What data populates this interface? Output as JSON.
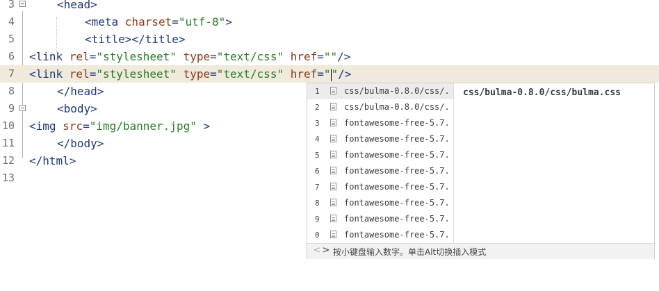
{
  "editor": {
    "lines": [
      {
        "num": "3",
        "parts": [
          [
            "tag",
            "<head>"
          ]
        ]
      },
      {
        "num": "4",
        "parts": [
          [
            "tag",
            "<meta "
          ],
          [
            "attr",
            "charset"
          ],
          [
            "eq",
            "="
          ],
          [
            "str",
            "\"utf-8\""
          ],
          [
            "tag",
            ">"
          ]
        ]
      },
      {
        "num": "5",
        "parts": [
          [
            "tag",
            "<title></title>"
          ]
        ]
      },
      {
        "num": "6",
        "parts": [
          [
            "tag",
            "<link "
          ],
          [
            "attr",
            "rel"
          ],
          [
            "eq",
            "="
          ],
          [
            "str",
            "\"stylesheet\""
          ],
          [
            "tag",
            " "
          ],
          [
            "attr",
            "type"
          ],
          [
            "eq",
            "="
          ],
          [
            "str",
            "\"text/css\""
          ],
          [
            "tag",
            " "
          ],
          [
            "attr",
            "href"
          ],
          [
            "eq",
            "="
          ],
          [
            "str",
            "\"\""
          ],
          [
            "tag",
            "/>"
          ]
        ]
      },
      {
        "num": "7",
        "parts": [
          [
            "tag",
            "<link "
          ],
          [
            "attr",
            "rel"
          ],
          [
            "eq",
            "="
          ],
          [
            "str",
            "\"stylesheet\""
          ],
          [
            "tag",
            " "
          ],
          [
            "attr",
            "type"
          ],
          [
            "eq",
            "="
          ],
          [
            "str",
            "\"text/css\""
          ],
          [
            "tag",
            " "
          ],
          [
            "attr",
            "href"
          ],
          [
            "eq",
            "="
          ],
          [
            "str",
            "\""
          ],
          [
            "caret",
            ""
          ],
          [
            "str",
            "\""
          ],
          [
            "tag",
            "/>"
          ]
        ]
      },
      {
        "num": "8",
        "parts": [
          [
            "tag",
            "</head>"
          ]
        ]
      },
      {
        "num": "9",
        "parts": [
          [
            "tag",
            "<body>"
          ]
        ]
      },
      {
        "num": "10",
        "parts": [
          [
            "tag",
            "<img "
          ],
          [
            "attr",
            "src"
          ],
          [
            "eq",
            "="
          ],
          [
            "str",
            "\"img/banner.jpg\""
          ],
          [
            "tag",
            " >"
          ]
        ]
      },
      {
        "num": "11",
        "parts": [
          [
            "tag",
            "</body>"
          ]
        ]
      },
      {
        "num": "12",
        "parts": [
          [
            "tag",
            "</html>"
          ]
        ]
      },
      {
        "num": "13",
        "parts": []
      }
    ]
  },
  "autocomplete": {
    "items": [
      {
        "num": "1",
        "text": "css/bulma-0.8.0/css/..."
      },
      {
        "num": "2",
        "text": "css/bulma-0.8.0/css/..."
      },
      {
        "num": "3",
        "text": "fontawesome-free-5.7..."
      },
      {
        "num": "4",
        "text": "fontawesome-free-5.7..."
      },
      {
        "num": "5",
        "text": "fontawesome-free-5.7..."
      },
      {
        "num": "6",
        "text": "fontawesome-free-5.7..."
      },
      {
        "num": "7",
        "text": "fontawesome-free-5.7..."
      },
      {
        "num": "8",
        "text": "fontawesome-free-5.7..."
      },
      {
        "num": "9",
        "text": "fontawesome-free-5.7..."
      },
      {
        "num": "0",
        "text": "fontawesome-free-5.7..."
      }
    ],
    "selected_detail": "css/bulma-0.8.0/css/bulma.css",
    "footer_hint": "按小键盘输入数字。单击Alt切换插入模式",
    "prev_arrow": "<",
    "next_arrow": ">"
  }
}
